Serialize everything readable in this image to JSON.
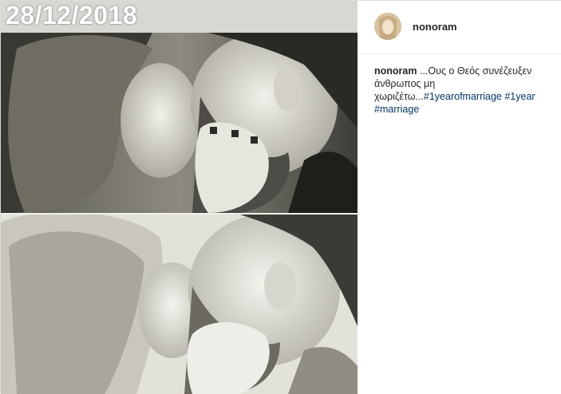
{
  "post": {
    "overlay_date": "28/12/2018",
    "author": {
      "username": "nonoram"
    },
    "caption": {
      "username": "nonoram",
      "text": "...Ους ο Θεός συνέζευξεν άνθρωπος μη χωριζέτω...",
      "hashtags": [
        "#1yearofmarriage",
        "#1year",
        "#marriage"
      ]
    }
  }
}
